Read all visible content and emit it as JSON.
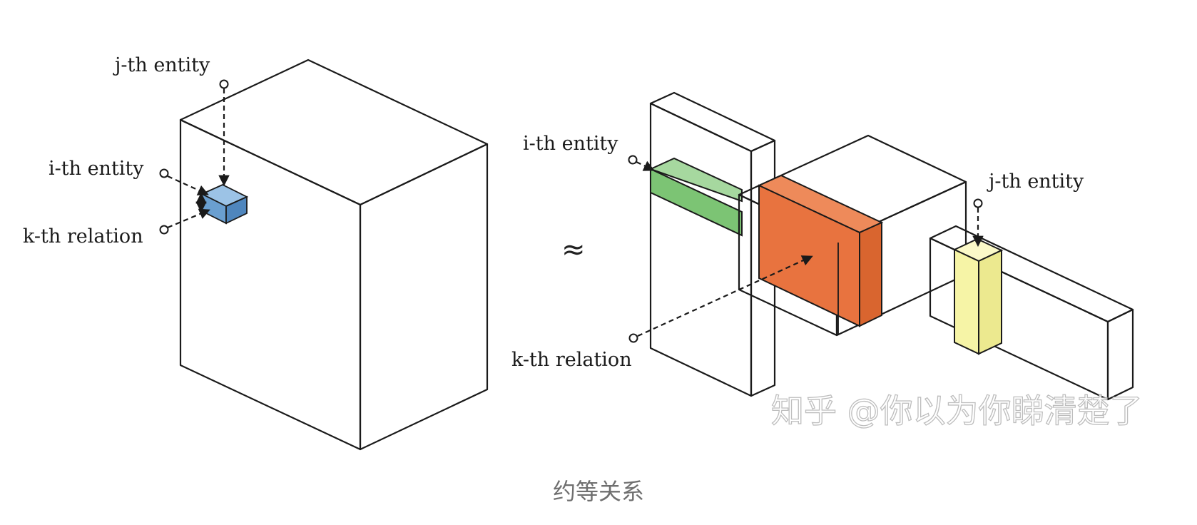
{
  "left_tensor": {
    "labels": {
      "j_entity": "j-th entity",
      "i_entity": "i-th entity",
      "k_relation": "k-th relation"
    }
  },
  "approx_symbol": "≈",
  "right_decomposition": {
    "labels": {
      "i_entity": "i-th entity",
      "j_entity": "j-th entity",
      "k_relation": "k-th relation"
    }
  },
  "colors": {
    "entry_cube": "#6a9fd0",
    "i_row_slice": "#7cc474",
    "core_slice": "#e8733f",
    "j_column_slice": "#f6f4a6",
    "outline": "#1a1a1a"
  },
  "watermark": "知乎 @你以为你睇清楚了",
  "caption": "约等关系"
}
